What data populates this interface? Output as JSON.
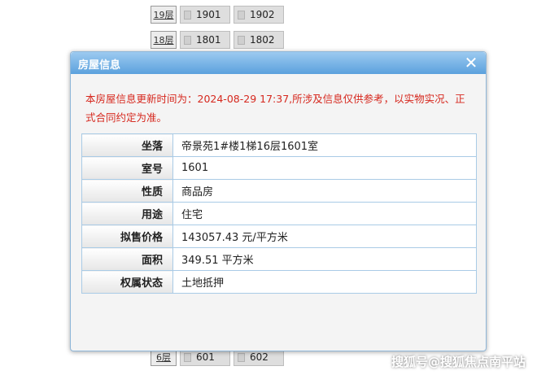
{
  "background": {
    "floors": [
      {
        "label": "19层",
        "units": [
          "1901",
          "1902"
        ]
      },
      {
        "label": "18层",
        "units": [
          "1801",
          "1802"
        ]
      },
      {
        "label": "6层",
        "units": [
          "601",
          "602"
        ]
      }
    ]
  },
  "dialog": {
    "title": "房屋信息",
    "notice": "本房屋信息更新时间为：2024-08-29 17:37,所涉及信息仅供参考，以实物实况、正式合同约定为准。",
    "rows": [
      {
        "key": "坐落",
        "value": "帝景苑1#楼1梯16层1601室"
      },
      {
        "key": "室号",
        "value": "1601"
      },
      {
        "key": "性质",
        "value": "商品房"
      },
      {
        "key": "用途",
        "value": "住宅"
      },
      {
        "key": "拟售价格",
        "value": "143057.43 元/平方米"
      },
      {
        "key": "面积",
        "value": "349.51 平方米"
      },
      {
        "key": "权属状态",
        "value": "土地抵押"
      }
    ],
    "colors": {
      "header": "#5ba1dd",
      "notice": "#d6281e",
      "border": "#a9cbe6"
    }
  },
  "watermark": "搜狐号@搜狐焦点南平站"
}
